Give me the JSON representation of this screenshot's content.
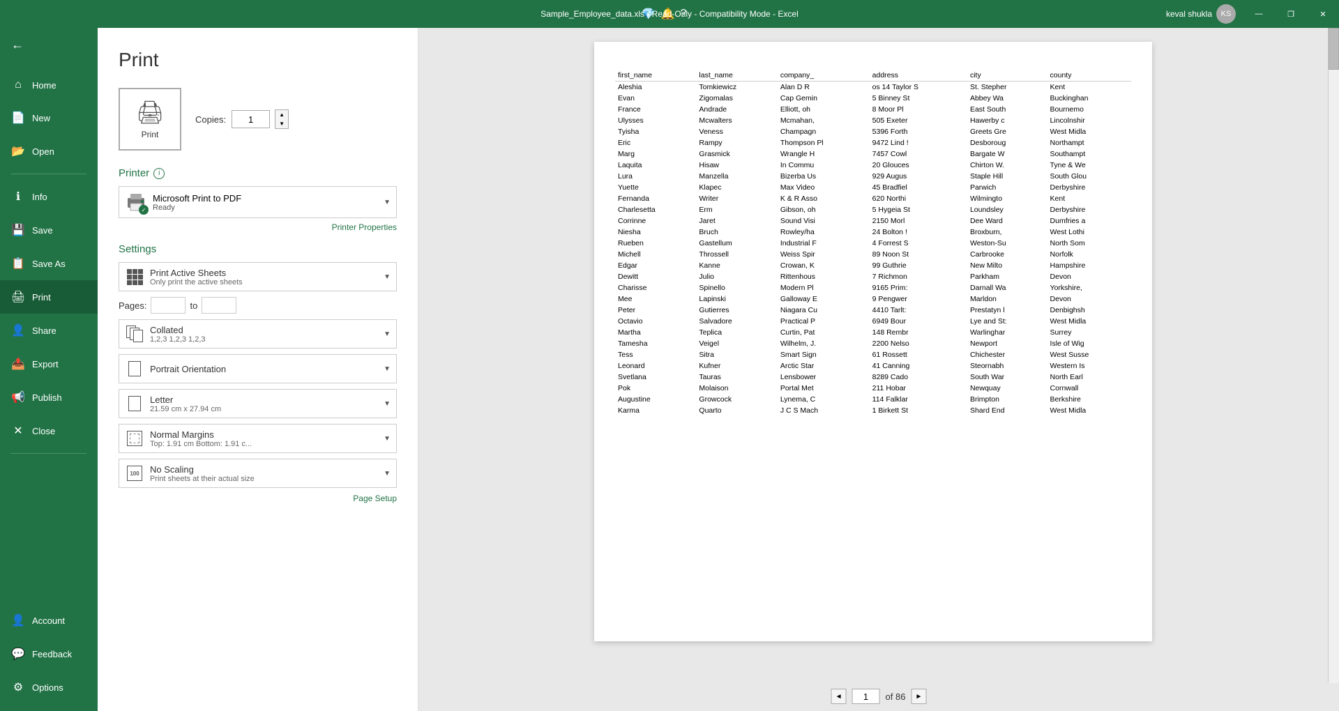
{
  "titlebar": {
    "filename": "Sample_Employee_data.xls",
    "mode": "Read-Only",
    "compatibility": "Compatibility Mode",
    "app": "Excel",
    "full_title": "Sample_Employee_data.xls - Read-Only - Compatibility Mode - Excel",
    "user": "keval shukla",
    "minimize": "—",
    "restore": "❐",
    "close": "✕"
  },
  "sidebar": {
    "back_icon": "←",
    "items": [
      {
        "id": "home",
        "label": "Home",
        "icon": "⌂"
      },
      {
        "id": "new",
        "label": "New",
        "icon": "📄"
      },
      {
        "id": "open",
        "label": "Open",
        "icon": "📂"
      }
    ],
    "divider1": true,
    "items2": [
      {
        "id": "info",
        "label": "Info",
        "icon": "ℹ"
      },
      {
        "id": "save",
        "label": "Save",
        "icon": "💾"
      },
      {
        "id": "saveas",
        "label": "Save As",
        "icon": "📋"
      },
      {
        "id": "print",
        "label": "Print",
        "icon": "🖨"
      },
      {
        "id": "share",
        "label": "Share",
        "icon": "👤"
      },
      {
        "id": "export",
        "label": "Export",
        "icon": "📤"
      },
      {
        "id": "publish",
        "label": "Publish",
        "icon": "📢"
      },
      {
        "id": "close",
        "label": "Close",
        "icon": "✕"
      }
    ],
    "divider2": true,
    "items3": [
      {
        "id": "account",
        "label": "Account",
        "icon": "👤"
      },
      {
        "id": "feedback",
        "label": "Feedback",
        "icon": "💬"
      },
      {
        "id": "options",
        "label": "Options",
        "icon": "⚙"
      }
    ]
  },
  "print": {
    "title": "Print",
    "copies_label": "Copies:",
    "copies_value": "1",
    "print_button_label": "Print",
    "printer_section": "Printer",
    "printer_name": "Microsoft Print to PDF",
    "printer_status": "Ready",
    "printer_properties": "Printer Properties",
    "settings_section": "Settings",
    "print_active_sheets": {
      "main": "Print Active Sheets",
      "sub": "Only print the active sheets"
    },
    "pages_label": "Pages:",
    "pages_from": "",
    "pages_to_label": "to",
    "pages_to": "",
    "collated": {
      "main": "Collated",
      "sub": "1,2,3  1,2,3  1,2,3"
    },
    "orientation": {
      "main": "Portrait Orientation",
      "sub": ""
    },
    "paper": {
      "main": "Letter",
      "sub": "21.59 cm x 27.94 cm"
    },
    "margins": {
      "main": "Normal Margins",
      "sub": "Top: 1.91 cm Bottom: 1.91 c..."
    },
    "scaling": {
      "main": "No Scaling",
      "sub": "Print sheets at their actual size"
    },
    "page_setup": "Page Setup"
  },
  "preview": {
    "page_current": "1",
    "page_total": "of 86",
    "prev_icon": "◄",
    "next_icon": "►",
    "table_headers": [
      "first_name",
      "last_name",
      "company_",
      "address",
      "city",
      "county"
    ],
    "rows": [
      [
        "Aleshia",
        "Tomkiewicz",
        "Alan D R",
        "os 14 Taylor S",
        "St. Stepher",
        "Kent"
      ],
      [
        "Evan",
        "Zigomalas",
        "Cap Gemin",
        "5 Binney St",
        "Abbey Wa",
        "Buckinghan"
      ],
      [
        "France",
        "Andrade",
        "Elliott, oh",
        "8 Moor Pl",
        "East South",
        "Bournemo"
      ],
      [
        "Ulysses",
        "Mcwalters",
        "Mcmahan,",
        "505 Exeter",
        "Hawerby c",
        "Lincolnshir"
      ],
      [
        "Tyisha",
        "Veness",
        "Champagn",
        "5396 Forth",
        "Greets Gre",
        "West Midla"
      ],
      [
        "Eric",
        "Rampy",
        "Thompson Pl",
        "9472 Lind !",
        "Desboroug",
        "Northampt"
      ],
      [
        "Marg",
        "Grasmick",
        "Wrangle H",
        "7457 Cowl",
        "Bargate W",
        "Southampt"
      ],
      [
        "Laquita",
        "Hisaw",
        "In Commu",
        "20 Glouces",
        "Chirton W.",
        "Tyne & We"
      ],
      [
        "Lura",
        "Manzella",
        "Bizerba Us",
        "929 Augus",
        "Staple Hill",
        "South Glou"
      ],
      [
        "Yuette",
        "Klapec",
        "Max Video",
        "45 Bradfiel",
        "Parwich",
        "Derbyshire"
      ],
      [
        "Fernanda",
        "Writer",
        "K & R Asso",
        "620 Northi",
        "Wilmingto",
        "Kent"
      ],
      [
        "Charlesetta",
        "Erm",
        "Gibson, oh",
        "5 Hygeia St",
        "Loundsley",
        "Derbyshire"
      ],
      [
        "Corrinne",
        "Jaret",
        "Sound Visi",
        "2150 Morl",
        "Dee Ward",
        "Dumfries a"
      ],
      [
        "Niesha",
        "Bruch",
        "Rowley/ha",
        "24 Bolton !",
        "Broxburn,",
        "West Lothi"
      ],
      [
        "Rueben",
        "Gastellum",
        "Industrial F",
        "4 Forrest S",
        "Weston-Su",
        "North Som"
      ],
      [
        "Michell",
        "Throssell",
        "Weiss Spir",
        "89 Noon St",
        "Carbrooke",
        "Norfolk"
      ],
      [
        "Edgar",
        "Kanne",
        "Crowan, K",
        "99 Guthrie",
        "New Milto",
        "Hampshire"
      ],
      [
        "Dewitt",
        "Julio",
        "Rittenhous",
        "7 Richmon",
        "Parkham",
        "Devon"
      ],
      [
        "Charisse",
        "Spinello",
        "Modern Pl",
        "9165 Prim:",
        "Darnall Wa",
        "Yorkshire,"
      ],
      [
        "Mee",
        "Lapinski",
        "Galloway E",
        "9 Pengwer",
        "Marldon",
        "Devon"
      ],
      [
        "Peter",
        "Gutierres",
        "Niagara Cu",
        "4410 Tarlt:",
        "Prestatyn l",
        "Denbighsh"
      ],
      [
        "Octavio",
        "Salvadore",
        "Practical P",
        "6949 Bour",
        "Lye and St:",
        "West Midla"
      ],
      [
        "Martha",
        "Teplica",
        "Curtin, Pat",
        "148 Rembr",
        "Warlinghar",
        "Surrey"
      ],
      [
        "Tamesha",
        "Veigel",
        "Wilhelm, J.",
        "2200 Nelso",
        "Newport",
        "Isle of Wig"
      ],
      [
        "Tess",
        "Sitra",
        "Smart Sign",
        "61 Rossett",
        "Chichester",
        "West Susse"
      ],
      [
        "Leonard",
        "Kufner",
        "Arctic Star",
        "41 Canning",
        "Steornabh",
        "Western Is"
      ],
      [
        "Svetlana",
        "Tauras",
        "Lensbower",
        "8289 Cado",
        "South War",
        "North Earl"
      ],
      [
        "Pok",
        "Molaison",
        "Portal Met",
        "211 Hobar",
        "Newquay",
        "Cornwall"
      ],
      [
        "Augustine",
        "Growcock",
        "Lynema, C",
        "114 Falklar",
        "Brimpton",
        "Berkshire"
      ],
      [
        "Karma",
        "Quarto",
        "J C S Mach",
        "1 Birkett St",
        "Shard End",
        "West Midla"
      ]
    ]
  }
}
